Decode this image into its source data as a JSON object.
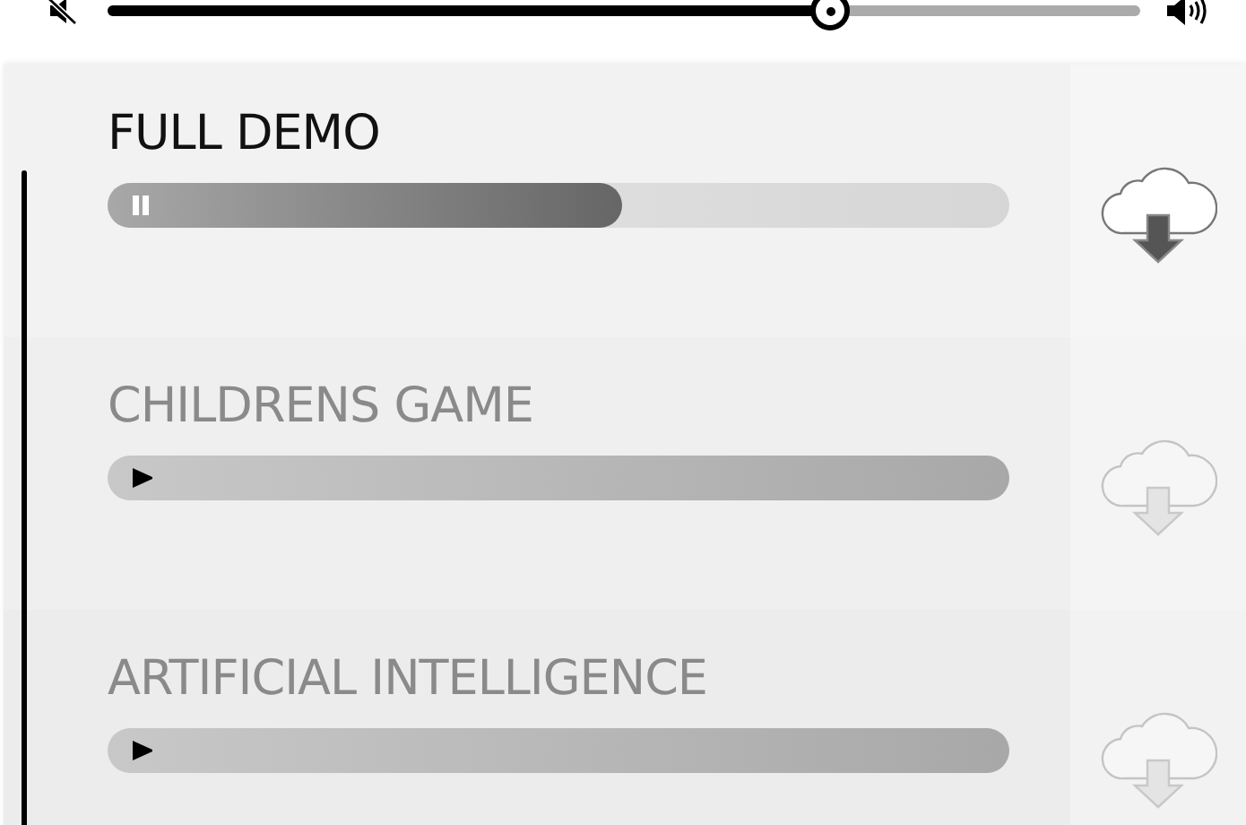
{
  "volume": {
    "level": 0.7
  },
  "tracks": [
    {
      "title": "FULL DEMO",
      "selected": true,
      "playing": true,
      "level": 0.57
    },
    {
      "title": "CHILDRENS GAME",
      "selected": false,
      "playing": false
    },
    {
      "title": "ARTIFICIAL INTELLIGENCE",
      "selected": false,
      "playing": false
    }
  ]
}
